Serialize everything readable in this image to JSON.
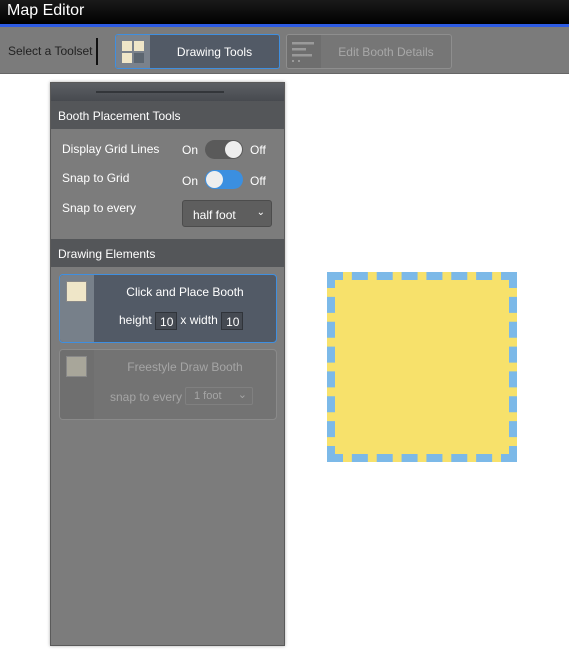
{
  "app": {
    "title": "Map Editor"
  },
  "toolbar": {
    "label": "Select a Toolset",
    "tools": [
      {
        "label": "Drawing Tools",
        "icon": "grid-icon",
        "active": true
      },
      {
        "label": "Edit Booth Details",
        "icon": "list-icon",
        "active": false
      }
    ]
  },
  "panel": {
    "placement": {
      "title": "Booth Placement Tools",
      "grid_lines": {
        "label": "Display Grid Lines",
        "on": "On",
        "off": "Off",
        "value": "Off"
      },
      "snap": {
        "label": "Snap to Grid",
        "on": "On",
        "off": "Off",
        "value": "On"
      },
      "snap_every": {
        "label": "Snap to every",
        "value": "half foot"
      }
    },
    "elements": {
      "title": "Drawing Elements",
      "click_place": {
        "title": "Click and Place Booth",
        "height_label": "height",
        "height": "10",
        "width_label": "x width",
        "width": "10"
      },
      "freestyle": {
        "title": "Freestyle Draw Booth",
        "snap_label": "snap to every",
        "snap_value": "1 foot"
      }
    }
  },
  "colors": {
    "accent": "#2d5be3",
    "booth_fill": "#f7e16b",
    "booth_border": "#7cb9e8",
    "active_border": "#3f8fe0"
  }
}
